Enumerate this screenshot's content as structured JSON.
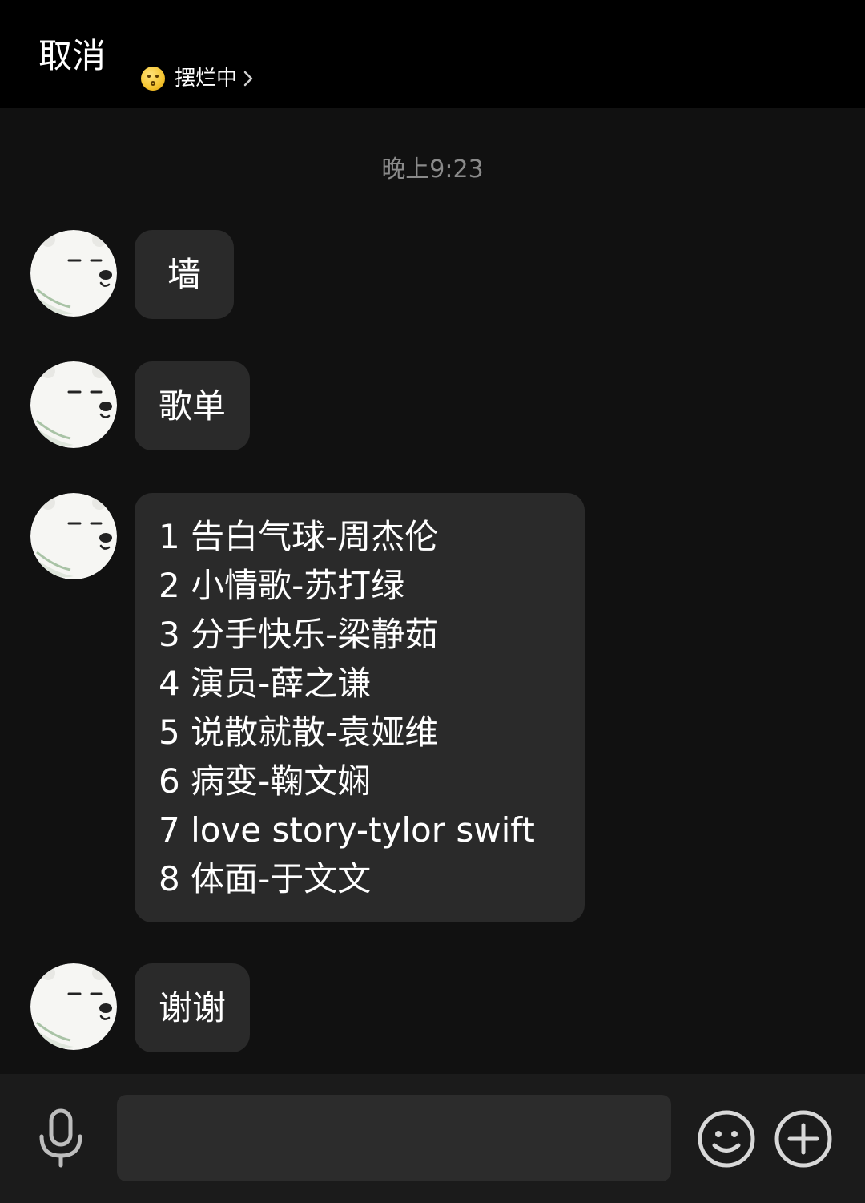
{
  "header": {
    "cancel_label": "取消",
    "status_label": "摆烂中"
  },
  "timestamp": "晚上9:23",
  "messages": [
    {
      "text": "墙"
    },
    {
      "text": "歌单"
    },
    {
      "lines": [
        "1 告白气球-周杰伦",
        "2 小情歌-苏打绿",
        "3 分手快乐-梁静茹",
        "4 演员-薛之谦",
        "5 说散就散-袁娅维",
        "6 病变-鞠文娴",
        "7 love story-tylor swift",
        "8 体面-于文文"
      ]
    },
    {
      "text": "谢谢"
    }
  ],
  "composer": {
    "value": "",
    "placeholder": ""
  },
  "icons": {
    "status": "thinking-face-icon",
    "chevron": "chevron-right-icon",
    "mic": "microphone-icon",
    "emoji": "smiley-icon",
    "more": "plus-circle-icon"
  },
  "colors": {
    "background": "#111111",
    "header": "#000000",
    "bubble": "#2a2a2a",
    "timestamp": "#8a8a8a"
  }
}
